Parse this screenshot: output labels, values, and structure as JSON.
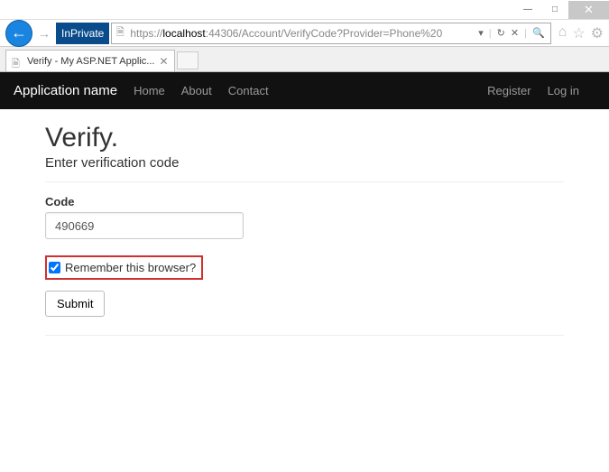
{
  "window": {
    "minimize": "—",
    "maximize": "□",
    "close": "✕"
  },
  "addressbar": {
    "inprivate": "InPrivate",
    "url_scheme_host": "https://",
    "url_host": "localhost",
    "url_port_path": ":44306/Account/VerifyCode?Provider=Phone%20",
    "dropdown": "▾",
    "refresh": "↻",
    "stop": "✕",
    "search": "🔍"
  },
  "toolbar_icons": {
    "home": "⌂",
    "favorites": "☆",
    "settings": "⚙"
  },
  "tab": {
    "title": "Verify - My ASP.NET Applic...",
    "close": "✕"
  },
  "navbar": {
    "brand": "Application name",
    "links": [
      "Home",
      "About",
      "Contact"
    ],
    "right_links": [
      "Register",
      "Log in"
    ]
  },
  "page": {
    "title": "Verify.",
    "subtitle": "Enter verification code",
    "code_label": "Code",
    "code_value": "490669",
    "remember_label": "Remember this browser?",
    "remember_checked": true,
    "submit_label": "Submit"
  }
}
